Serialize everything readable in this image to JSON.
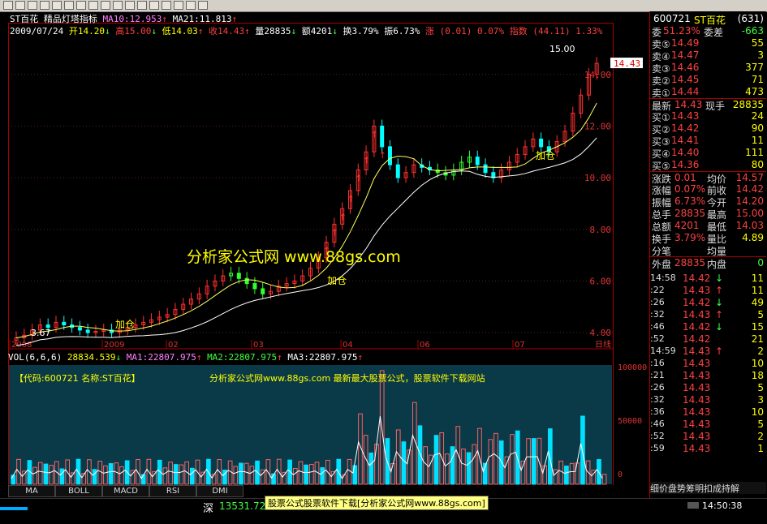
{
  "toolbar": {
    "icons": [
      "back-icon",
      "forward-icon",
      "chart-icon",
      "table-icon",
      "grid-icon",
      "bar-icon",
      "list-icon",
      "pen-icon",
      "cursor-icon",
      "zoom-icon",
      "tool-icon",
      "refresh-icon",
      "search-icon",
      "layout-icon",
      "star-icon",
      "window-icon",
      "help-icon"
    ]
  },
  "header": {
    "stock_name": "ST百花",
    "indicator_name": "精品灯塔指标",
    "ma10": "MA10:12.953",
    "ma21": "MA21:11.813",
    "date": "2009/07/24",
    "open": "开14.20",
    "high": "高15.00",
    "low": "低14.03",
    "close": "收14.43",
    "volume": "量28835",
    "amount": "额4201",
    "turnover": "换3.79%",
    "amplitude": "振6.73%",
    "change": "涨 (0.01) 0.07%",
    "index": "指数 (44.11) 1.33%"
  },
  "price_axis": [
    "14.00",
    "12.00",
    "10.00",
    "8.00",
    "6.00",
    "4.00"
  ],
  "price_tag": "14.43",
  "high_label": "15.00",
  "low_label": "3.67",
  "time_axis": [
    "2008",
    "2009",
    "02",
    "03",
    "04",
    "06",
    "07"
  ],
  "day_label": "日线",
  "annotations": [
    "加仓",
    "加仓",
    "加仓"
  ],
  "watermark": "分析家公式网 www.88gs.com",
  "vol_header": {
    "vol": "VOL(6,6,6)",
    "v": "28834.539",
    "ma1": "MA1:22807.975",
    "ma2": "MA2:22807.975",
    "ma3": "MA3:22807.975"
  },
  "vol_banner": "【代码:600721 名称:ST百花】",
  "vol_banner2": "分析家公式网www.88gs.com 最新最大股票公式，股票软件下载网站",
  "vol_axis": [
    "100000",
    "50000",
    "0"
  ],
  "tabs": [
    "MA",
    "BOLL",
    "MACD",
    "RSI",
    "DMI"
  ],
  "status": {
    "market": "深",
    "index_value": "13531.72",
    "ad_text": "股票公式股票软件下载[分析家公式网www.88gs.com]",
    "time": "14:50:38"
  },
  "quote": {
    "code": "600721",
    "name": "ST百花",
    "num": "(631)",
    "weibi_label": "委比",
    "weibi": "51.23%",
    "weicha_label": "委差",
    "weicha": "-663",
    "sells": [
      {
        "label": "卖⑤",
        "price": "14.49",
        "vol": "55"
      },
      {
        "label": "卖④",
        "price": "14.47",
        "vol": "3"
      },
      {
        "label": "卖③",
        "price": "14.46",
        "vol": "377"
      },
      {
        "label": "卖②",
        "price": "14.45",
        "vol": "71"
      },
      {
        "label": "卖①",
        "price": "14.44",
        "vol": "473"
      }
    ],
    "latest_label": "最新",
    "latest": "14.43",
    "xianshou_label": "现手",
    "xianshou": "28835",
    "buys": [
      {
        "label": "买①",
        "price": "14.43",
        "vol": "24"
      },
      {
        "label": "买②",
        "price": "14.42",
        "vol": "90"
      },
      {
        "label": "买③",
        "price": "14.41",
        "vol": "11"
      },
      {
        "label": "买④",
        "price": "14.40",
        "vol": "111"
      },
      {
        "label": "买⑤",
        "price": "14.36",
        "vol": "80"
      }
    ],
    "stats": [
      {
        "l1": "涨跌",
        "v1": "0.01",
        "l2": "均价",
        "v2": "14.57"
      },
      {
        "l1": "涨幅",
        "v1": "0.07%",
        "l2": "前收",
        "v2": "14.42"
      },
      {
        "l1": "振幅",
        "v1": "6.73%",
        "l2": "今开",
        "v2": "14.20"
      },
      {
        "l1": "总手",
        "v1": "28835",
        "l2": "最高",
        "v2": "15.00"
      },
      {
        "l1": "总额",
        "v1": "4201",
        "l2": "最低",
        "v2": "14.03"
      },
      {
        "l1": "换手",
        "v1": "3.79%",
        "l2": "量比",
        "v2": "4.89"
      }
    ],
    "fenbi": "分笔",
    "junliang": "均量",
    "waipan_label": "外盘",
    "waipan": "28835",
    "neipan_label": "内盘",
    "neipan": "0",
    "ticks": [
      {
        "t": "14:58",
        "p": "14.42",
        "d": "↓",
        "v": "11"
      },
      {
        "t": ":22",
        "p": "14.43",
        "d": "↑",
        "v": "11"
      },
      {
        "t": ":26",
        "p": "14.42",
        "d": "↓",
        "v": "49"
      },
      {
        "t": ":32",
        "p": "14.43",
        "d": "↑",
        "v": "5"
      },
      {
        "t": ":46",
        "p": "14.42",
        "d": "↓",
        "v": "15"
      },
      {
        "t": ":52",
        "p": "14.42",
        "d": "",
        "v": "21"
      },
      {
        "t": "14:59",
        "p": "14.43",
        "d": "↑",
        "v": "2"
      },
      {
        "t": ":16",
        "p": "14.43",
        "d": "",
        "v": "10"
      },
      {
        "t": ":21",
        "p": "14.43",
        "d": "",
        "v": "18"
      },
      {
        "t": ":26",
        "p": "14.43",
        "d": "",
        "v": "5"
      },
      {
        "t": ":32",
        "p": "14.43",
        "d": "",
        "v": "3"
      },
      {
        "t": ":36",
        "p": "14.43",
        "d": "",
        "v": "10"
      },
      {
        "t": ":46",
        "p": "14.43",
        "d": "",
        "v": "5"
      },
      {
        "t": ":52",
        "p": "14.43",
        "d": "",
        "v": "2"
      },
      {
        "t": ":59",
        "p": "14.43",
        "d": "",
        "v": "1"
      }
    ],
    "bottom_tabs": "细价盘势筹明扣成持解"
  },
  "chart_data": {
    "type": "candlestick",
    "title": "ST百花 精品灯塔指标",
    "ylim": [
      3.5,
      15.5
    ],
    "x": [
      "2008",
      "2009",
      "02",
      "03",
      "04",
      "06",
      "07"
    ],
    "closes": [
      3.8,
      3.9,
      4.1,
      4.3,
      4.2,
      4.4,
      4.3,
      4.2,
      4.1,
      4.0,
      4.05,
      4.1,
      4.0,
      4.1,
      4.2,
      4.3,
      4.4,
      4.5,
      4.6,
      4.7,
      4.9,
      5.1,
      5.3,
      5.5,
      5.8,
      6.0,
      6.2,
      6.3,
      6.1,
      5.9,
      5.7,
      5.5,
      5.6,
      5.8,
      5.9,
      6.0,
      6.2,
      6.5,
      6.9,
      7.5,
      8.2,
      8.8,
      9.5,
      10.3,
      11.0,
      12.0,
      11.2,
      10.5,
      10.0,
      10.2,
      10.5,
      10.4,
      10.3,
      10.2,
      10.1,
      10.3,
      10.6,
      10.8,
      10.5,
      10.2,
      10.0,
      10.3,
      10.6,
      10.9,
      11.2,
      11.5,
      11.2,
      11.0,
      11.4,
      11.8,
      12.5,
      13.2,
      14.0,
      14.43
    ],
    "volume_ylim": [
      0,
      100000
    ]
  }
}
